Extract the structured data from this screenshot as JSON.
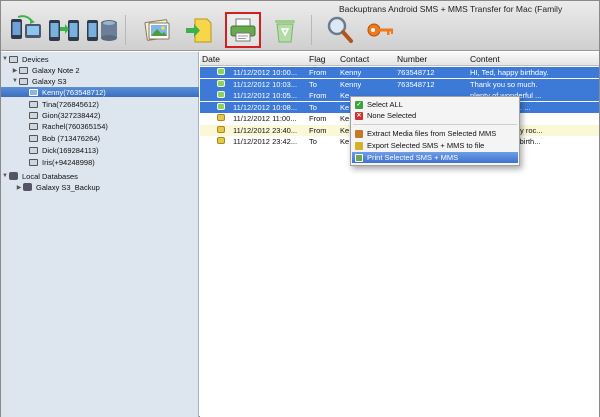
{
  "window": {
    "title": "Backuptrans Android SMS + MMS Transfer for Mac (Family"
  },
  "toolbar": {
    "buttons": [
      {
        "icon": "phone-to-computer-icon"
      },
      {
        "icon": "phone-to-phone-icon"
      },
      {
        "icon": "phone-database-icon"
      },
      {
        "icon": "photo-album-icon"
      },
      {
        "icon": "export-file-icon"
      },
      {
        "icon": "printer-icon",
        "active": true
      },
      {
        "icon": "recycle-bin-icon"
      },
      {
        "icon": "search-icon"
      },
      {
        "icon": "register-key-icon"
      }
    ]
  },
  "sidebar": {
    "devices_label": "Devices",
    "devices": [
      {
        "label": "Galaxy Note 2",
        "expanded": false
      },
      {
        "label": "Galaxy S3",
        "expanded": true
      }
    ],
    "contacts": [
      {
        "label": "Kenny(763548712)",
        "selected": true
      },
      {
        "label": "Tina(726845612)"
      },
      {
        "label": "Gion(327238442)"
      },
      {
        "label": "Rachel(760365154)"
      },
      {
        "label": "Bob (713476264)"
      },
      {
        "label": "Dick(169284113)"
      },
      {
        "label": "Iris(+94248998)"
      }
    ],
    "local_label": "Local Databases",
    "local": [
      {
        "label": "Galaxy S3_Backup"
      }
    ]
  },
  "table": {
    "columns": {
      "date": "Date",
      "flag": "Flag",
      "contact": "Contact",
      "number": "Number",
      "content": "Content"
    },
    "rows": [
      {
        "date": "11/12/2012 10:00...",
        "flag": "From",
        "contact": "Kenny",
        "number": "763548712",
        "content": "HI, Ted, happy birthday.",
        "style": "sel"
      },
      {
        "date": "11/12/2012 10:03...",
        "flag": "To",
        "contact": "Kenny",
        "number": "763548712",
        "content": "Thank you so much.",
        "style": "sel"
      },
      {
        "date": "11/12/2012 10:05...",
        "flag": "From",
        "contact": "Ke",
        "number": "",
        "content": "plenty of wonderful ...",
        "style": "sel"
      },
      {
        "date": "11/12/2012 10:08...",
        "flag": "To",
        "contact": "Ke",
        "number": "",
        "content": "e party at 8 pm. ...",
        "style": "sel"
      },
      {
        "date": "11/12/2012 11:00...",
        "flag": "From",
        "contact": "Ke",
        "number": "",
        "content": "",
        "style": "plain"
      },
      {
        "date": "11/12/2012 23:40...",
        "flag": "From",
        "contact": "Ke",
        "number": "",
        "content": "e invite. It totally roc...",
        "style": "yel"
      },
      {
        "date": "11/12/2012 23:42...",
        "flag": "To",
        "contact": "Ke",
        "number": "",
        "content": "r attending my birth...",
        "style": "plain"
      }
    ]
  },
  "context_menu": {
    "items": [
      {
        "label": "Select ALL",
        "icon": "checkmark-icon",
        "color": "#3aa53a"
      },
      {
        "label": "None Selected",
        "icon": "x-mark-icon",
        "color": "#d03030"
      },
      {
        "label": "Extract Media files from Selected MMS",
        "icon": "media-extract-icon",
        "color": "#c07a2a"
      },
      {
        "label": "Export Selected SMS + MMS to file",
        "icon": "export-icon",
        "color": "#d4b22a"
      },
      {
        "label": "Print Selected SMS + MMS",
        "icon": "printer-icon",
        "color": "#6aa84f",
        "highlighted": true
      }
    ]
  },
  "colors": {
    "selection": "#3d7ad8",
    "sidebar_bg": "#dde5ef",
    "active_outline": "#d02020"
  }
}
